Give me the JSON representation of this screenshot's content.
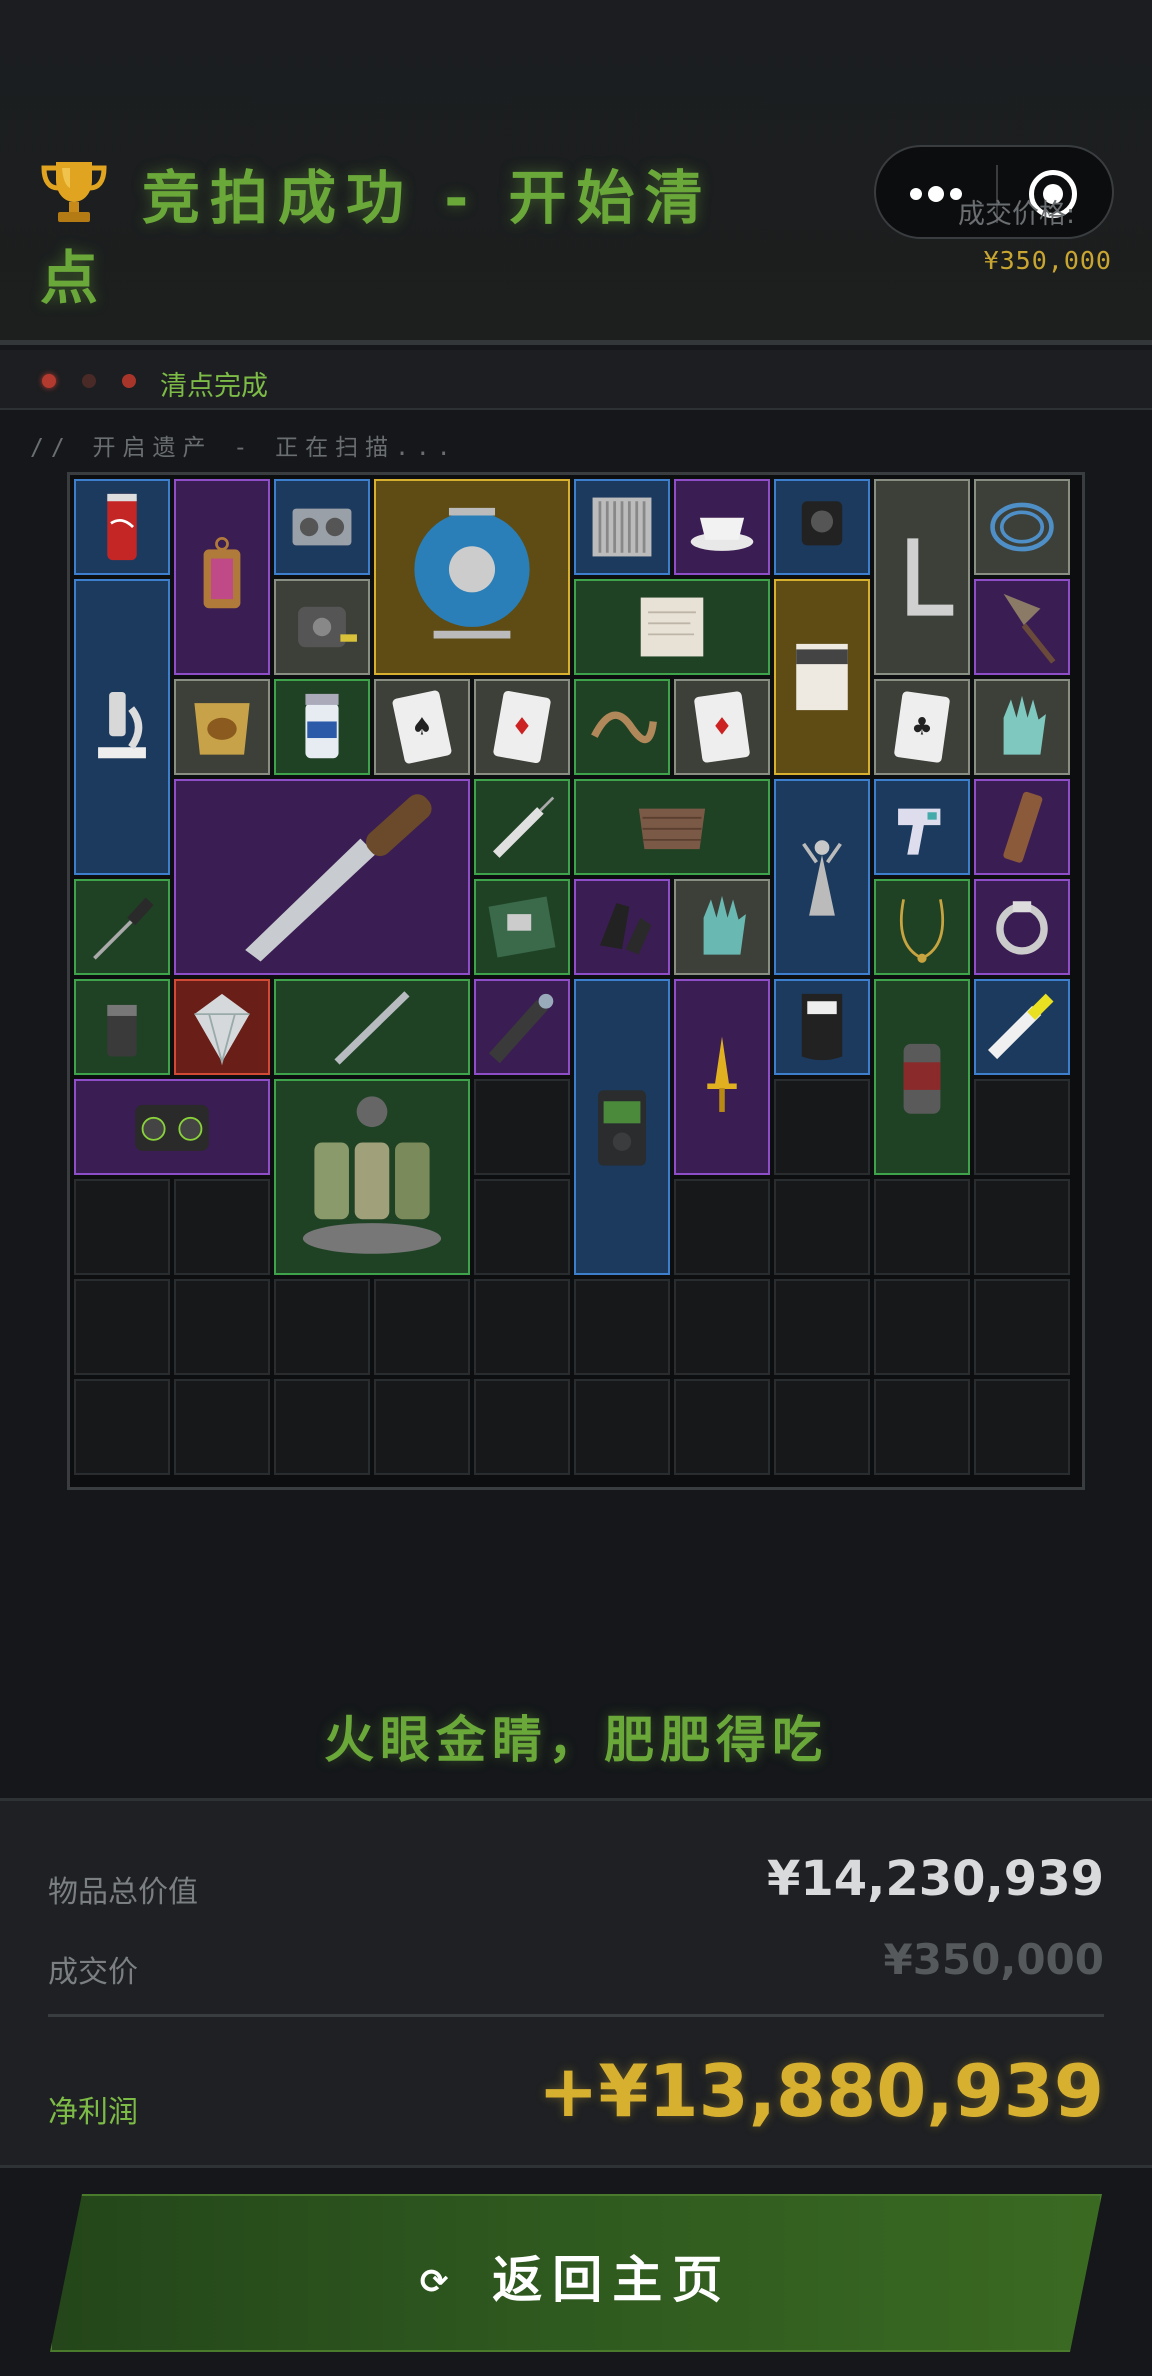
{
  "header": {
    "title": "竞拍成功 - 开始清点",
    "deal_price_label": "成交价格:",
    "deal_price": "¥350,000"
  },
  "status": {
    "text": "清点完成",
    "scan_text": "// 开启遗产 - 正在扫描..."
  },
  "slogan": "火眼金睛，肥肥得吃",
  "summary": {
    "total_label": "物品总价值",
    "total_value": "¥14,230,939",
    "deal_label": "成交价",
    "deal_value": "¥350,000",
    "profit_label": "净利润",
    "profit_value": "+¥13,880,939"
  },
  "return_button": {
    "label": "返回主页",
    "icon": "refresh-icon"
  },
  "colors": {
    "accent_green": "#6aa83a",
    "gold": "#d8b030",
    "rarity_blue": "#3d7fcc",
    "rarity_purple": "#8d4ec7",
    "rarity_gray": "#8a8f84",
    "rarity_green": "#3ea34a",
    "rarity_gold": "#d8b030",
    "rarity_red": "#d14a36"
  },
  "grid_items": [
    {
      "name": "soda-can",
      "rarity": "blue"
    },
    {
      "name": "lantern",
      "rarity": "purple"
    },
    {
      "name": "tape-reel",
      "rarity": "blue"
    },
    {
      "name": "cable-reel",
      "rarity": "gold"
    },
    {
      "name": "radiator-grill",
      "rarity": "blue"
    },
    {
      "name": "teacup",
      "rarity": "purple"
    },
    {
      "name": "action-camera",
      "rarity": "blue"
    },
    {
      "name": "l-square-ruler",
      "rarity": "gray"
    },
    {
      "name": "cable-coil",
      "rarity": "gray"
    },
    {
      "name": "microscope",
      "rarity": "blue"
    },
    {
      "name": "tape-measure",
      "rarity": "gray"
    },
    {
      "name": "paper-sheet",
      "rarity": "green"
    },
    {
      "name": "barista-box",
      "rarity": "gold"
    },
    {
      "name": "spearhead",
      "rarity": "purple"
    },
    {
      "name": "chips-bag",
      "rarity": "gray"
    },
    {
      "name": "pill-bottle",
      "rarity": "green"
    },
    {
      "name": "playing-card-spades",
      "rarity": "gray"
    },
    {
      "name": "playing-card-diamonds",
      "rarity": "gray"
    },
    {
      "name": "rubber-hose",
      "rarity": "green"
    },
    {
      "name": "playing-card-diamond",
      "rarity": "gray"
    },
    {
      "name": "playing-card-club",
      "rarity": "gray"
    },
    {
      "name": "glove",
      "rarity": "gray"
    },
    {
      "name": "hunting-knife",
      "rarity": "purple"
    },
    {
      "name": "syringe",
      "rarity": "green"
    },
    {
      "name": "wood-planks",
      "rarity": "green"
    },
    {
      "name": "statue",
      "rarity": "blue"
    },
    {
      "name": "thermometer-gun",
      "rarity": "blue"
    },
    {
      "name": "energy-bar",
      "rarity": "purple"
    },
    {
      "name": "screwdriver",
      "rarity": "green"
    },
    {
      "name": "circuit-board",
      "rarity": "green"
    },
    {
      "name": "tactical-holder",
      "rarity": "purple"
    },
    {
      "name": "blue-glove",
      "rarity": "gray"
    },
    {
      "name": "necklace",
      "rarity": "green"
    },
    {
      "name": "ring",
      "rarity": "purple"
    },
    {
      "name": "lighter",
      "rarity": "green"
    },
    {
      "name": "diamond",
      "rarity": "red"
    },
    {
      "name": "metal-rod",
      "rarity": "green"
    },
    {
      "name": "flashlight",
      "rarity": "purple"
    },
    {
      "name": "voice-recorder",
      "rarity": "blue"
    },
    {
      "name": "golden-dagger",
      "rarity": "purple"
    },
    {
      "name": "pouch",
      "rarity": "blue"
    },
    {
      "name": "spray-can",
      "rarity": "green"
    },
    {
      "name": "glue-tube",
      "rarity": "blue"
    },
    {
      "name": "boombox",
      "rarity": "purple"
    },
    {
      "name": "spice-rack",
      "rarity": "green"
    }
  ]
}
